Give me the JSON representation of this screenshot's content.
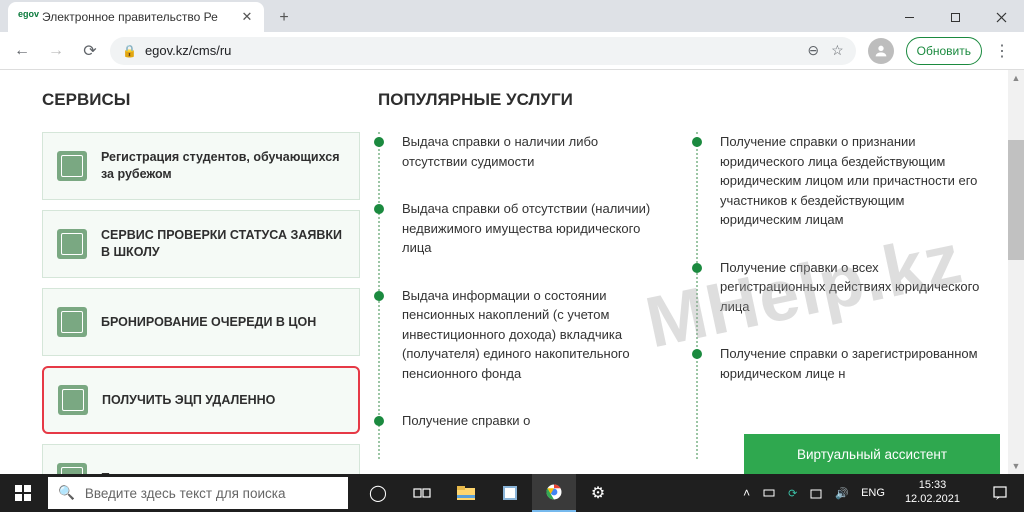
{
  "browser": {
    "tab_title": "Электронное правительство Ре",
    "favicon_text": "egov",
    "url": "egov.kz/cms/ru",
    "update_label": "Обновить"
  },
  "page": {
    "services_heading": "СЕРВИСЫ",
    "popular_heading": "ПОПУЛЯРНЫЕ УСЛУГИ",
    "services": [
      "Регистрация студентов, обучающихся за рубежом",
      "СЕРВИС ПРОВЕРКИ СТАТУСА ЗАЯВКИ В ШКОЛУ",
      "БРОНИРОВАНИЕ ОЧЕРЕДИ В ЦОН",
      "ПОЛУЧИТЬ ЭЦП УДАЛЕННО",
      "Поиск наличия залога движимого"
    ],
    "highlight_index": 3,
    "popular_left": [
      "Выдача справки о наличии либо отсутствии судимости",
      "Выдача справки об отсутствии (наличии) недвижимого имущества юридического лица",
      "Выдача информации о состоянии пенсионных накоплений (с учетом инвестиционного дохода) вкладчика (получателя) единого накопительного пенсионного фонда",
      "Получение справки о"
    ],
    "popular_right": [
      "Получение справки о признании юридического лица бездействующим юридическим лицом или причастности его участников к бездействующим юридическим лицам",
      "Получение справки о всех регистрационных действиях юридического лица",
      "Получение справки о зарегистрированном юридическом лице н"
    ],
    "va_button": "Виртуальный ассистент",
    "watermark": "MHelp.kz"
  },
  "taskbar": {
    "search_placeholder": "Введите здесь текст для поиска",
    "lang": "ENG",
    "time": "15:33",
    "date": "12.02.2021"
  }
}
